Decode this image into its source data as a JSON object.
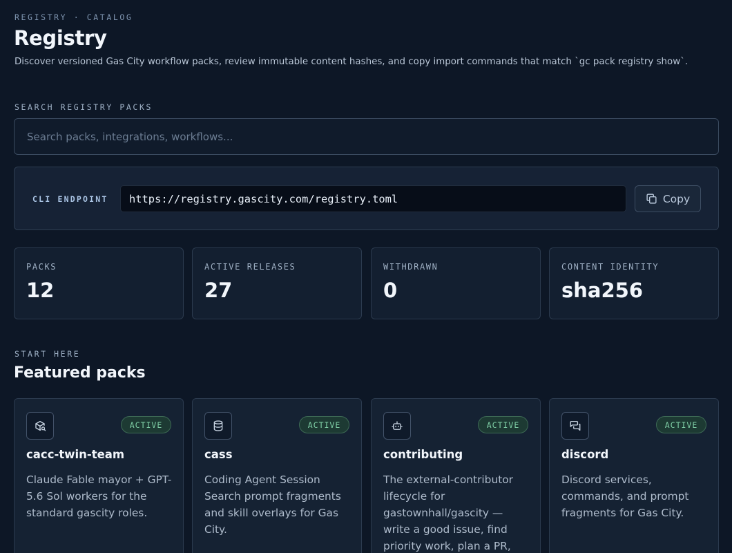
{
  "header": {
    "breadcrumb": "REGISTRY · CATALOG",
    "title": "Registry",
    "subtitle": "Discover versioned Gas City workflow packs, review immutable content hashes, and copy import commands that match `gc pack registry show`."
  },
  "search": {
    "label": "SEARCH REGISTRY PACKS",
    "placeholder": "Search packs, integrations, workflows..."
  },
  "endpoint": {
    "label": "CLI ENDPOINT",
    "url": "https://registry.gascity.com/registry.toml",
    "copy_label": "Copy",
    "copy_icon": "copy-icon"
  },
  "stats": [
    {
      "label": "PACKS",
      "value": "12"
    },
    {
      "label": "ACTIVE RELEASES",
      "value": "27"
    },
    {
      "label": "WITHDRAWN",
      "value": "0"
    },
    {
      "label": "CONTENT IDENTITY",
      "value": "sha256"
    }
  ],
  "featured": {
    "eyebrow": "START HERE",
    "title": "Featured packs",
    "cards": [
      {
        "icon": "package-search-icon",
        "status": "ACTIVE",
        "name": "cacc-twin-team",
        "description": "Claude Fable mayor + GPT-5.6 Sol workers for the standard gascity roles."
      },
      {
        "icon": "database-icon",
        "status": "ACTIVE",
        "name": "cass",
        "description": "Coding Agent Session Search prompt fragments and skill overlays for Gas City."
      },
      {
        "icon": "bot-icon",
        "status": "ACTIVE",
        "name": "contributing",
        "description": "The external-contributor lifecycle for gastownhall/gascity — write a good issue, find priority work, plan a PR,"
      },
      {
        "icon": "chat-bubbles-icon",
        "status": "ACTIVE",
        "name": "discord",
        "description": "Discord services, commands, and prompt fragments for Gas City."
      }
    ]
  },
  "colors": {
    "background": "#0d1726",
    "accent_status": "#7fcfa6",
    "card": "#152233"
  }
}
